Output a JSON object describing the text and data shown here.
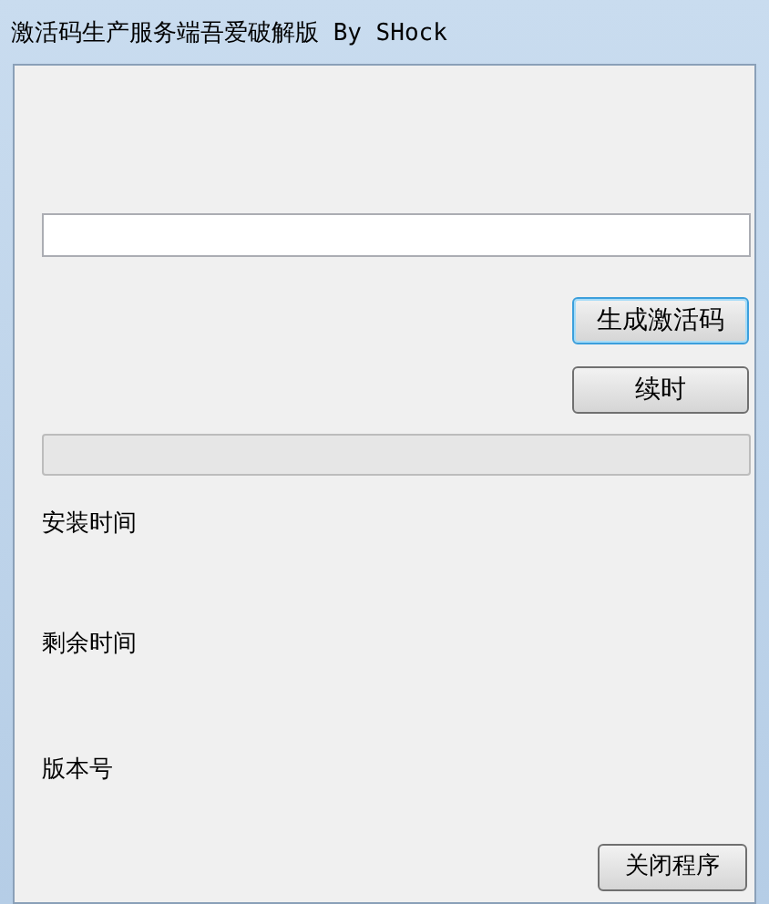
{
  "window": {
    "title": "激活码生产服务端吾爱破解版 By SHock"
  },
  "buttons": [
    {
      "label": "生成激活码",
      "focused": true
    },
    {
      "label": "续时",
      "focused": false
    }
  ],
  "progress": {
    "level": 0
  },
  "labels": [
    "安装时间",
    "剩余时间",
    "版本号"
  ],
  "close_button": {
    "label": "关闭程序"
  }
}
